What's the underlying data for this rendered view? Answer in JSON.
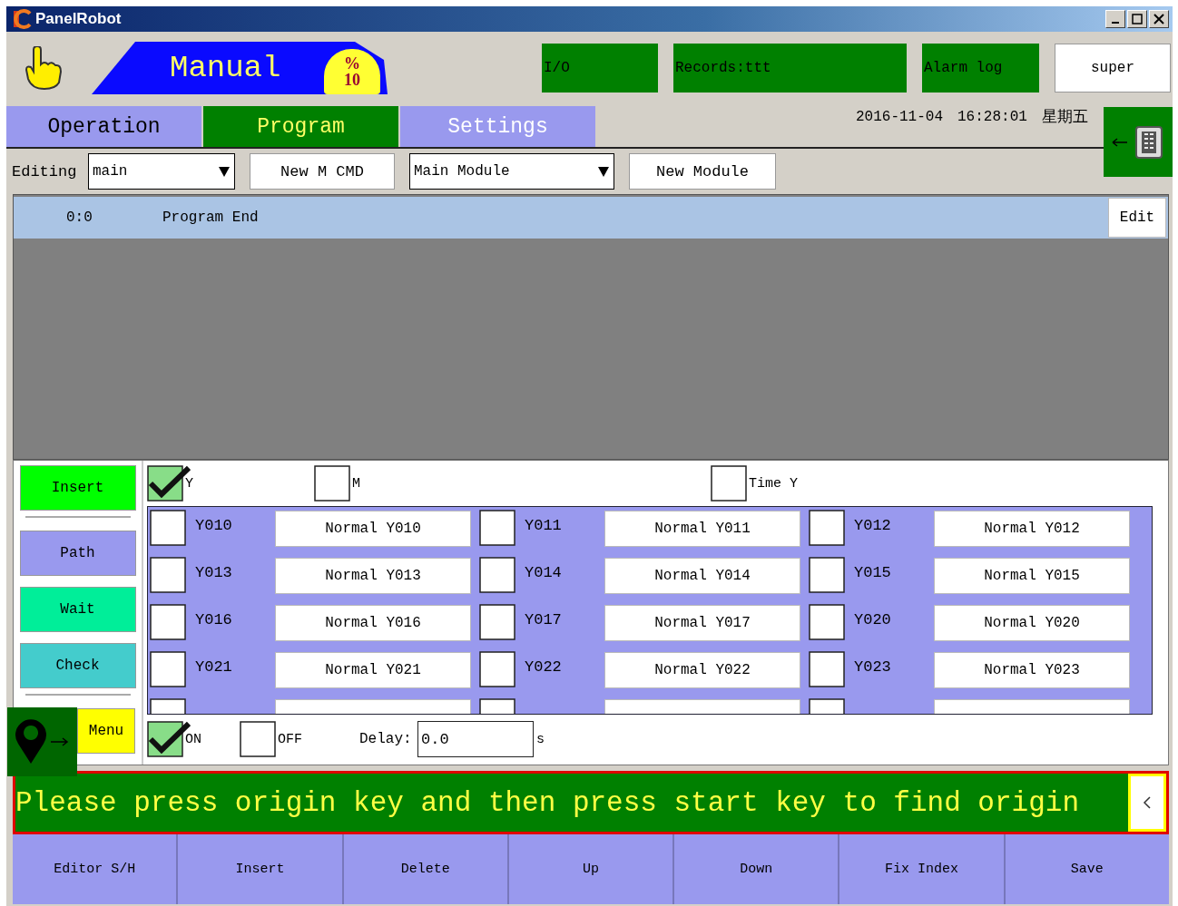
{
  "window": {
    "title": "PanelRobot"
  },
  "header": {
    "mode": "Manual",
    "speed_symbol": "%",
    "speed": "10",
    "buttons": [
      {
        "label": "I/O"
      },
      {
        "label": "Records:ttt"
      },
      {
        "label": "Alarm log"
      }
    ],
    "user": "super"
  },
  "tabs": [
    {
      "label": "Operation",
      "selected": false,
      "disabled": false
    },
    {
      "label": "Program",
      "selected": true,
      "disabled": false
    },
    {
      "label": "Settings",
      "selected": false,
      "disabled": true
    }
  ],
  "datetime": {
    "date": "2016-11-04",
    "time": "16:28:01",
    "weekday": "星期五"
  },
  "toolbar": {
    "label": "Editing",
    "program_select": "main",
    "new_cmd_button": "New M CMD",
    "module_select": "Main Module",
    "new_module_button": "New Module"
  },
  "program": {
    "rows": [
      {
        "index": "0:0",
        "text": "Program End",
        "selected": true
      }
    ],
    "edit_button": "Edit"
  },
  "editor": {
    "categories": [
      {
        "label": "Insert",
        "color": "#00ff00"
      },
      {
        "label": "Path",
        "color": "#9999ee"
      },
      {
        "label": "Wait",
        "color": "#00ee99"
      },
      {
        "label": "Check",
        "color": "#44cccc"
      },
      {
        "label": "Menu",
        "color": "#ffff00"
      }
    ],
    "type_options": [
      {
        "label": "Y",
        "checked": true
      },
      {
        "label": "M",
        "checked": false
      },
      {
        "label": "Time Y",
        "checked": false
      }
    ],
    "outputs": [
      {
        "label": "Y010",
        "value": "Normal Y010",
        "checked": false
      },
      {
        "label": "Y011",
        "value": "Normal Y011",
        "checked": false
      },
      {
        "label": "Y012",
        "value": "Normal Y012",
        "checked": false
      },
      {
        "label": "Y013",
        "value": "Normal Y013",
        "checked": false
      },
      {
        "label": "Y014",
        "value": "Normal Y014",
        "checked": false
      },
      {
        "label": "Y015",
        "value": "Normal Y015",
        "checked": false
      },
      {
        "label": "Y016",
        "value": "Normal Y016",
        "checked": false
      },
      {
        "label": "Y017",
        "value": "Normal Y017",
        "checked": false
      },
      {
        "label": "Y020",
        "value": "Normal Y020",
        "checked": false
      },
      {
        "label": "Y021",
        "value": "Normal Y021",
        "checked": false
      },
      {
        "label": "Y022",
        "value": "Normal Y022",
        "checked": false
      },
      {
        "label": "Y023",
        "value": "Normal Y023",
        "checked": false
      }
    ],
    "cut_off_outputs": [
      {
        "checked": false
      },
      {
        "checked": false
      },
      {
        "checked": false
      }
    ],
    "switches": [
      {
        "label": "ON",
        "checked": true
      },
      {
        "label": "OFF",
        "checked": false
      }
    ],
    "delay": {
      "label": "Delay:",
      "value": "0.0",
      "unit": "s"
    }
  },
  "message": "Please press origin key and then press start key to find origin",
  "footer": [
    "Editor S/H",
    "Insert",
    "Delete",
    "Up",
    "Down",
    "Fix Index",
    "Save"
  ]
}
